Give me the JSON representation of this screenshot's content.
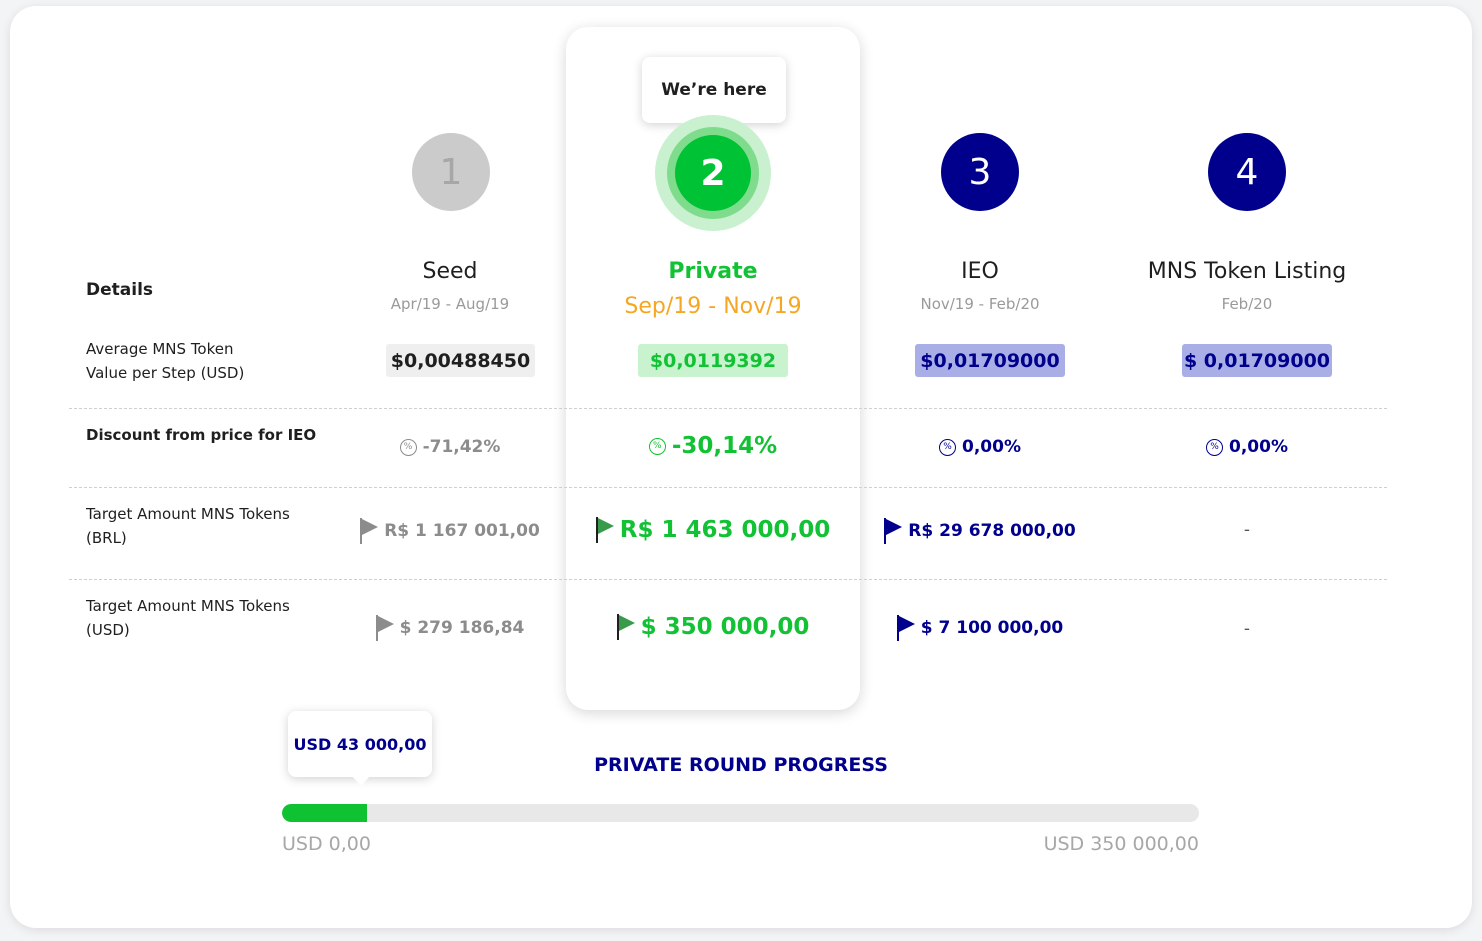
{
  "here_label": "We’re here",
  "details_label": "Details",
  "stages": [
    {
      "number": "1",
      "name": "Seed",
      "dates": "Apr/19 - Aug/19",
      "price": "$0,00488450",
      "discount": "-71,42%",
      "target_brl": "R$ 1 167 001,00",
      "target_usd": "$ 279 186,84"
    },
    {
      "number": "2",
      "name": "Private",
      "dates": "Sep/19 - Nov/19",
      "price": "$0,0119392",
      "discount": "-30,14%",
      "target_brl": "R$ 1 463 000,00",
      "target_usd": "$ 350 000,00"
    },
    {
      "number": "3",
      "name": "IEO",
      "dates": "Nov/19 - Feb/20",
      "price": "$0,01709000",
      "discount": "0,00%",
      "target_brl": "R$ 29 678 000,00",
      "target_usd": "$ 7 100 000,00"
    },
    {
      "number": "4",
      "name": "MNS Token Listing",
      "dates": "Feb/20",
      "price": "$ 0,01709000",
      "discount": "0,00%",
      "target_brl": "-",
      "target_usd": "-"
    }
  ],
  "rows": {
    "avg_value_line1": "Average MNS Token",
    "avg_value_line2": "Value per Step (USD)",
    "discount": "Discount from price for IEO",
    "target_brl_line1": "Target Amount MNS Tokens",
    "target_brl_line2": "(BRL)",
    "target_usd_line1": "Target Amount MNS Tokens",
    "target_usd_line2": "(USD)"
  },
  "percent_icon": "percent-badge-icon",
  "flag_icon": "flag-icon",
  "progress": {
    "title": "PRIVATE ROUND PROGRESS",
    "current": "USD 43 000,00",
    "min_label": "USD 0,00",
    "max_label": "USD 350 000,00",
    "fraction": 0.0926
  },
  "colors": {
    "green": "#12c234",
    "navy": "#00008c",
    "orange": "#f5a623",
    "gray": "#8c8c8c"
  }
}
